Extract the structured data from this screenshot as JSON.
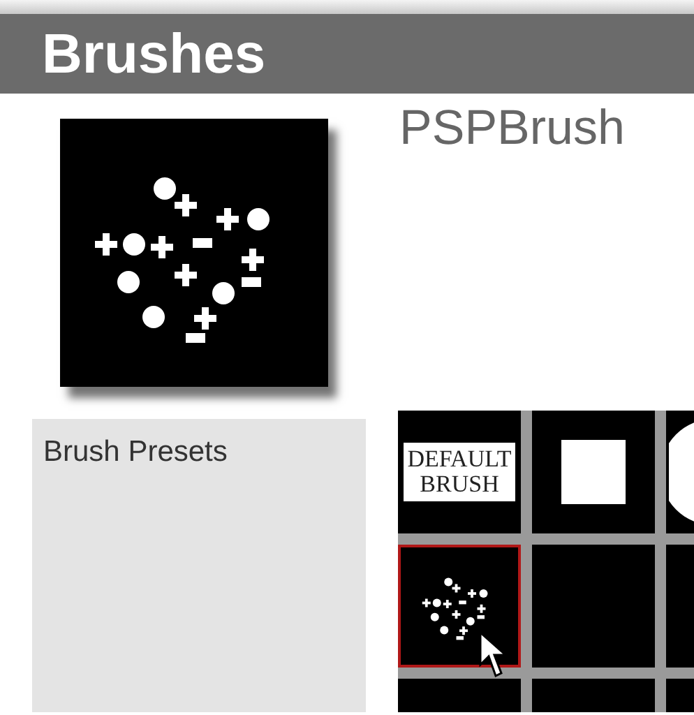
{
  "panel": {
    "title": "Brushes"
  },
  "brush_name": "PSPBrush",
  "presets_label": "Brush Presets",
  "presets": [
    {
      "kind": "default",
      "label": "DEFAULT BRUSH",
      "selected": false
    },
    {
      "kind": "square",
      "selected": false
    },
    {
      "kind": "circle",
      "selected": false
    },
    {
      "kind": "scatter",
      "selected": true
    },
    {
      "kind": "empty",
      "selected": false
    },
    {
      "kind": "empty",
      "selected": false
    },
    {
      "kind": "empty",
      "selected": false
    },
    {
      "kind": "empty",
      "selected": false
    },
    {
      "kind": "empty",
      "selected": false
    }
  ]
}
